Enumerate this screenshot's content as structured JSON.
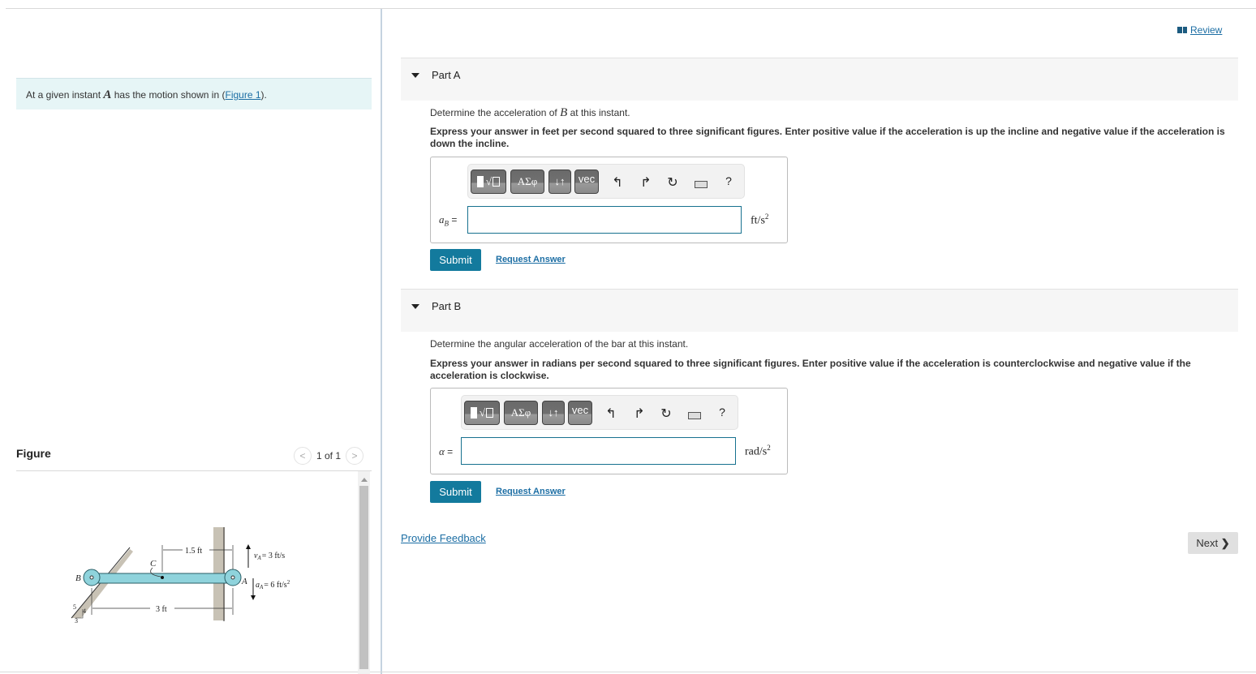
{
  "header": {
    "review_label": "Review",
    "review_icon": "book-icon"
  },
  "intro": {
    "prefix": "At a given instant ",
    "math": "A",
    "middle": " has the motion shown in (",
    "figure_link": "Figure 1",
    "suffix": ")."
  },
  "figure": {
    "title": "Figure",
    "pager": "1 of 1",
    "prev_icon": "chevron-left-icon",
    "next_icon": "chevron-right-icon",
    "labels": {
      "B": "B",
      "C": "C",
      "A": "A",
      "dim_top": "1.5 ft",
      "dim_bottom": "3 ft",
      "vA": "v",
      "vA_sub": "A",
      "vA_value": "= 3 ft/s",
      "aA": "a",
      "aA_sub": "A",
      "aA_value": "= 6 ft/s",
      "aA_exp": "2",
      "slope_5": "5",
      "slope_4": "4",
      "slope_3": "3"
    }
  },
  "parts": [
    {
      "title": "Part A",
      "question_prefix": "Determine the acceleration of ",
      "question_math": "B",
      "question_suffix": " at this instant.",
      "instruction": "Express your answer in feet per second squared to three significant figures. Enter positive value if the acceleration is up the incline and negative value if the acceleration is down the incline.",
      "answer_label": "a",
      "answer_label_sub": "B",
      "answer_eq": " =",
      "answer_value": "",
      "unit": "ft/s",
      "unit_exp": "2",
      "submit_label": "Submit",
      "request_label": "Request Answer"
    },
    {
      "title": "Part B",
      "question_prefix": "Determine the angular acceleration of the bar at this instant.",
      "question_math": "",
      "question_suffix": "",
      "instruction": "Express your answer in radians per second squared to three significant figures. Enter positive value if the acceleration is counterclockwise and negative value if the acceleration is clockwise.",
      "answer_label": "α",
      "answer_label_sub": "",
      "answer_eq": " =",
      "answer_value": "",
      "unit": "rad/s",
      "unit_exp": "2",
      "submit_label": "Submit",
      "request_label": "Request Answer"
    }
  ],
  "toolbar": {
    "templates_label": "√",
    "greek_label": "ΑΣφ",
    "updown_label": "↓↑",
    "vec_label": "vec",
    "undo_icon": "↰",
    "redo_icon": "↱",
    "reset_icon": "↻",
    "help_label": "?"
  },
  "footer": {
    "feedback_label": "Provide Feedback",
    "next_label": "Next",
    "next_icon": "❯"
  }
}
